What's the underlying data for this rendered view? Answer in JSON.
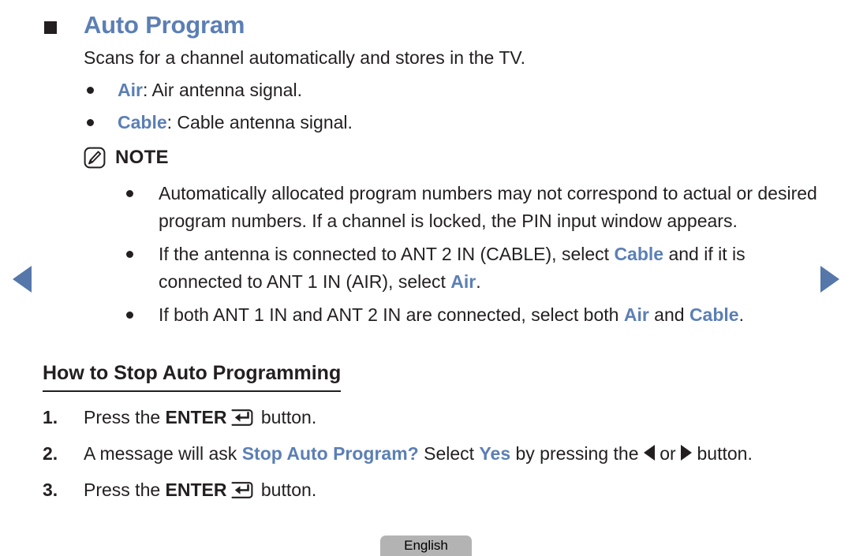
{
  "section": {
    "bullet_icon": "filled-square-bullet",
    "title": "Auto Program",
    "title_color": "#5b7fb5",
    "description": "Scans for a channel automatically and stores in the TV."
  },
  "source_options": [
    {
      "term": "Air",
      "definition": ": Air antenna signal."
    },
    {
      "term": "Cable",
      "definition": ": Cable antenna signal."
    }
  ],
  "note": {
    "icon": "note-pen-icon",
    "label": "NOTE",
    "items": [
      {
        "parts": [
          {
            "text": "Automatically allocated program numbers may not correspond to actual or desired program numbers. If a channel is locked, the PIN input window appears.",
            "style": "plain"
          }
        ]
      },
      {
        "parts": [
          {
            "text": "If the antenna is connected to ANT 2 IN (CABLE), select ",
            "style": "plain"
          },
          {
            "text": "Cable",
            "style": "blue-bold"
          },
          {
            "text": " and if it is connected to ANT 1 IN (AIR), select ",
            "style": "plain"
          },
          {
            "text": "Air",
            "style": "blue-bold"
          },
          {
            "text": ".",
            "style": "plain"
          }
        ]
      },
      {
        "parts": [
          {
            "text": "If both ANT 1 IN and ANT 2 IN are connected, select both ",
            "style": "plain"
          },
          {
            "text": "Air",
            "style": "blue-bold"
          },
          {
            "text": " and ",
            "style": "plain"
          },
          {
            "text": "Cable",
            "style": "blue-bold"
          },
          {
            "text": ".",
            "style": "plain"
          }
        ]
      }
    ]
  },
  "subsection": {
    "heading": "How to Stop Auto Programming",
    "steps": [
      {
        "number": "1.",
        "segments": [
          {
            "text": "Press the ",
            "style": "plain"
          },
          {
            "text": "ENTER",
            "style": "bold"
          },
          {
            "text": "",
            "style": "enter-key-icon"
          },
          {
            "text": " button.",
            "style": "plain"
          }
        ]
      },
      {
        "number": "2.",
        "segments": [
          {
            "text": "A message will ask ",
            "style": "plain"
          },
          {
            "text": "Stop Auto Program?",
            "style": "blue-bold"
          },
          {
            "text": " Select ",
            "style": "plain"
          },
          {
            "text": "Yes",
            "style": "blue-bold"
          },
          {
            "text": " by pressing the ",
            "style": "plain"
          },
          {
            "text": "",
            "style": "left-triangle-icon"
          },
          {
            "text": " or ",
            "style": "plain"
          },
          {
            "text": "",
            "style": "right-triangle-icon"
          },
          {
            "text": " button.",
            "style": "plain"
          }
        ]
      },
      {
        "number": "3.",
        "segments": [
          {
            "text": "Press the ",
            "style": "plain"
          },
          {
            "text": "ENTER",
            "style": "bold"
          },
          {
            "text": "",
            "style": "enter-key-icon"
          },
          {
            "text": " button.",
            "style": "plain"
          }
        ]
      }
    ]
  },
  "navigation": {
    "prev_icon": "left-triangle-nav-icon",
    "next_icon": "right-triangle-nav-icon",
    "arrow_color": "#5577aa"
  },
  "footer": {
    "language_label": "English"
  }
}
